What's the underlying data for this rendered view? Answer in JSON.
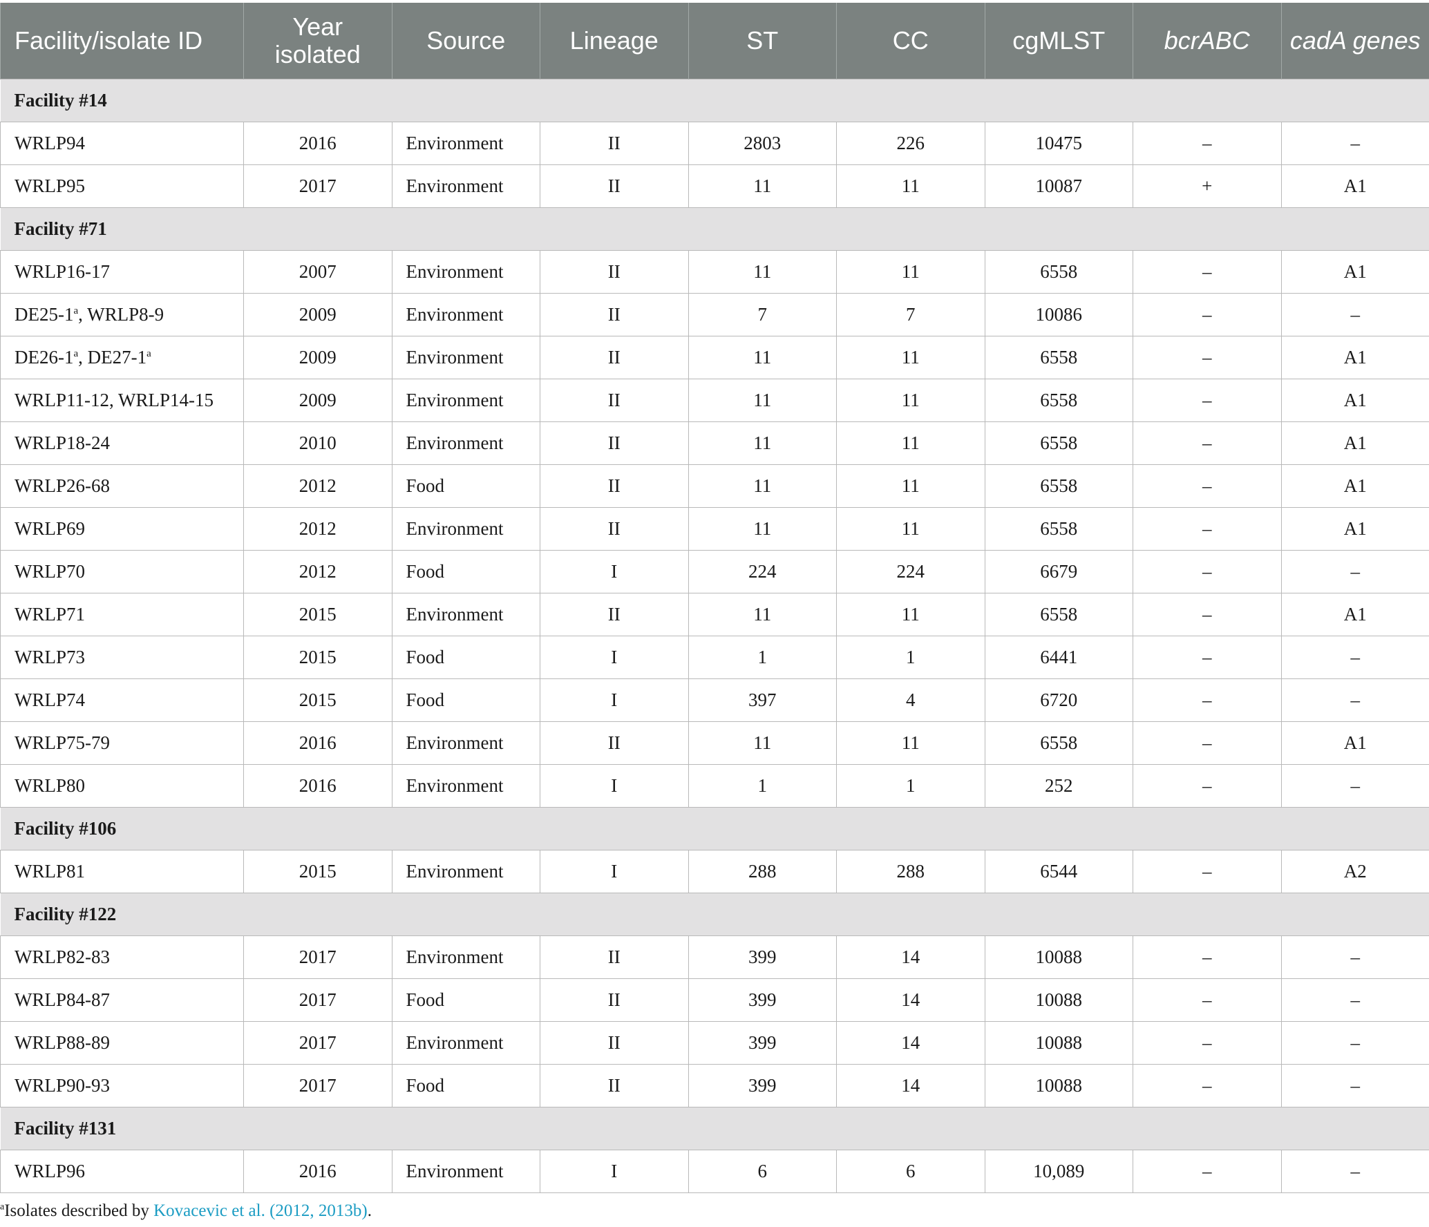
{
  "headers": [
    "Facility/isolate ID",
    "Year isolated",
    "Source",
    "Lineage",
    "ST",
    "CC",
    "cgMLST",
    "bcrABC",
    "cadA genes"
  ],
  "groups": [
    {
      "name": "Facility #14",
      "rows": [
        {
          "id": "WRLP94",
          "year": "2016",
          "source": "Environment",
          "lineage": "II",
          "st": "2803",
          "cc": "226",
          "cgmlst": "10475",
          "bcr": "–",
          "cad": "–"
        },
        {
          "id": "WRLP95",
          "year": "2017",
          "source": "Environment",
          "lineage": "II",
          "st": "11",
          "cc": "11",
          "cgmlst": "10087",
          "bcr": "+",
          "cad": "A1"
        }
      ]
    },
    {
      "name": "Facility #71",
      "rows": [
        {
          "id": "WRLP16-17",
          "year": "2007",
          "source": "Environment",
          "lineage": "II",
          "st": "11",
          "cc": "11",
          "cgmlst": "6558",
          "bcr": "–",
          "cad": "A1"
        },
        {
          "id": "DE25-1ᵃ, WRLP8-9",
          "year": "2009",
          "source": "Environment",
          "lineage": "II",
          "st": "7",
          "cc": "7",
          "cgmlst": "10086",
          "bcr": "–",
          "cad": "–"
        },
        {
          "id": "DE26-1ᵃ, DE27-1ᵃ",
          "year": "2009",
          "source": "Environment",
          "lineage": "II",
          "st": "11",
          "cc": "11",
          "cgmlst": "6558",
          "bcr": "–",
          "cad": "A1"
        },
        {
          "id": "WRLP11-12, WRLP14-15",
          "year": "2009",
          "source": "Environment",
          "lineage": "II",
          "st": "11",
          "cc": "11",
          "cgmlst": "6558",
          "bcr": "–",
          "cad": "A1"
        },
        {
          "id": "WRLP18-24",
          "year": "2010",
          "source": "Environment",
          "lineage": "II",
          "st": "11",
          "cc": "11",
          "cgmlst": "6558",
          "bcr": "–",
          "cad": "A1"
        },
        {
          "id": "WRLP26-68",
          "year": "2012",
          "source": "Food",
          "lineage": "II",
          "st": "11",
          "cc": "11",
          "cgmlst": "6558",
          "bcr": "–",
          "cad": "A1"
        },
        {
          "id": "WRLP69",
          "year": "2012",
          "source": "Environment",
          "lineage": "II",
          "st": "11",
          "cc": "11",
          "cgmlst": "6558",
          "bcr": "–",
          "cad": "A1"
        },
        {
          "id": "WRLP70",
          "year": "2012",
          "source": "Food",
          "lineage": "I",
          "st": "224",
          "cc": "224",
          "cgmlst": "6679",
          "bcr": "–",
          "cad": "–"
        },
        {
          "id": "WRLP71",
          "year": "2015",
          "source": "Environment",
          "lineage": "II",
          "st": "11",
          "cc": "11",
          "cgmlst": "6558",
          "bcr": "–",
          "cad": "A1"
        },
        {
          "id": "WRLP73",
          "year": "2015",
          "source": "Food",
          "lineage": "I",
          "st": "1",
          "cc": "1",
          "cgmlst": "6441",
          "bcr": "–",
          "cad": "–"
        },
        {
          "id": "WRLP74",
          "year": "2015",
          "source": "Food",
          "lineage": "I",
          "st": "397",
          "cc": "4",
          "cgmlst": "6720",
          "bcr": "–",
          "cad": "–"
        },
        {
          "id": "WRLP75-79",
          "year": "2016",
          "source": "Environment",
          "lineage": "II",
          "st": "11",
          "cc": "11",
          "cgmlst": "6558",
          "bcr": "–",
          "cad": "A1"
        },
        {
          "id": "WRLP80",
          "year": "2016",
          "source": "Environment",
          "lineage": "I",
          "st": "1",
          "cc": "1",
          "cgmlst": "252",
          "bcr": "–",
          "cad": "–"
        }
      ]
    },
    {
      "name": "Facility #106",
      "rows": [
        {
          "id": "WRLP81",
          "year": "2015",
          "source": "Environment",
          "lineage": "I",
          "st": "288",
          "cc": "288",
          "cgmlst": "6544",
          "bcr": "–",
          "cad": "A2"
        }
      ]
    },
    {
      "name": "Facility #122",
      "rows": [
        {
          "id": "WRLP82-83",
          "year": "2017",
          "source": "Environment",
          "lineage": "II",
          "st": "399",
          "cc": "14",
          "cgmlst": "10088",
          "bcr": "–",
          "cad": "–"
        },
        {
          "id": "WRLP84-87",
          "year": "2017",
          "source": "Food",
          "lineage": "II",
          "st": "399",
          "cc": "14",
          "cgmlst": "10088",
          "bcr": "–",
          "cad": "–"
        },
        {
          "id": "WRLP88-89",
          "year": "2017",
          "source": "Environment",
          "lineage": "II",
          "st": "399",
          "cc": "14",
          "cgmlst": "10088",
          "bcr": "–",
          "cad": "–"
        },
        {
          "id": "WRLP90-93",
          "year": "2017",
          "source": "Food",
          "lineage": "II",
          "st": "399",
          "cc": "14",
          "cgmlst": "10088",
          "bcr": "–",
          "cad": "–"
        }
      ]
    },
    {
      "name": "Facility #131",
      "rows": [
        {
          "id": "WRLP96",
          "year": "2016",
          "source": "Environment",
          "lineage": "I",
          "st": "6",
          "cc": "6",
          "cgmlst": "10,089",
          "bcr": "–",
          "cad": "–"
        }
      ]
    }
  ],
  "footnote": {
    "marker": "a",
    "text": "Isolates described by ",
    "reference": "Kovacevic et al. (2012, 2013b)",
    "end": "."
  }
}
